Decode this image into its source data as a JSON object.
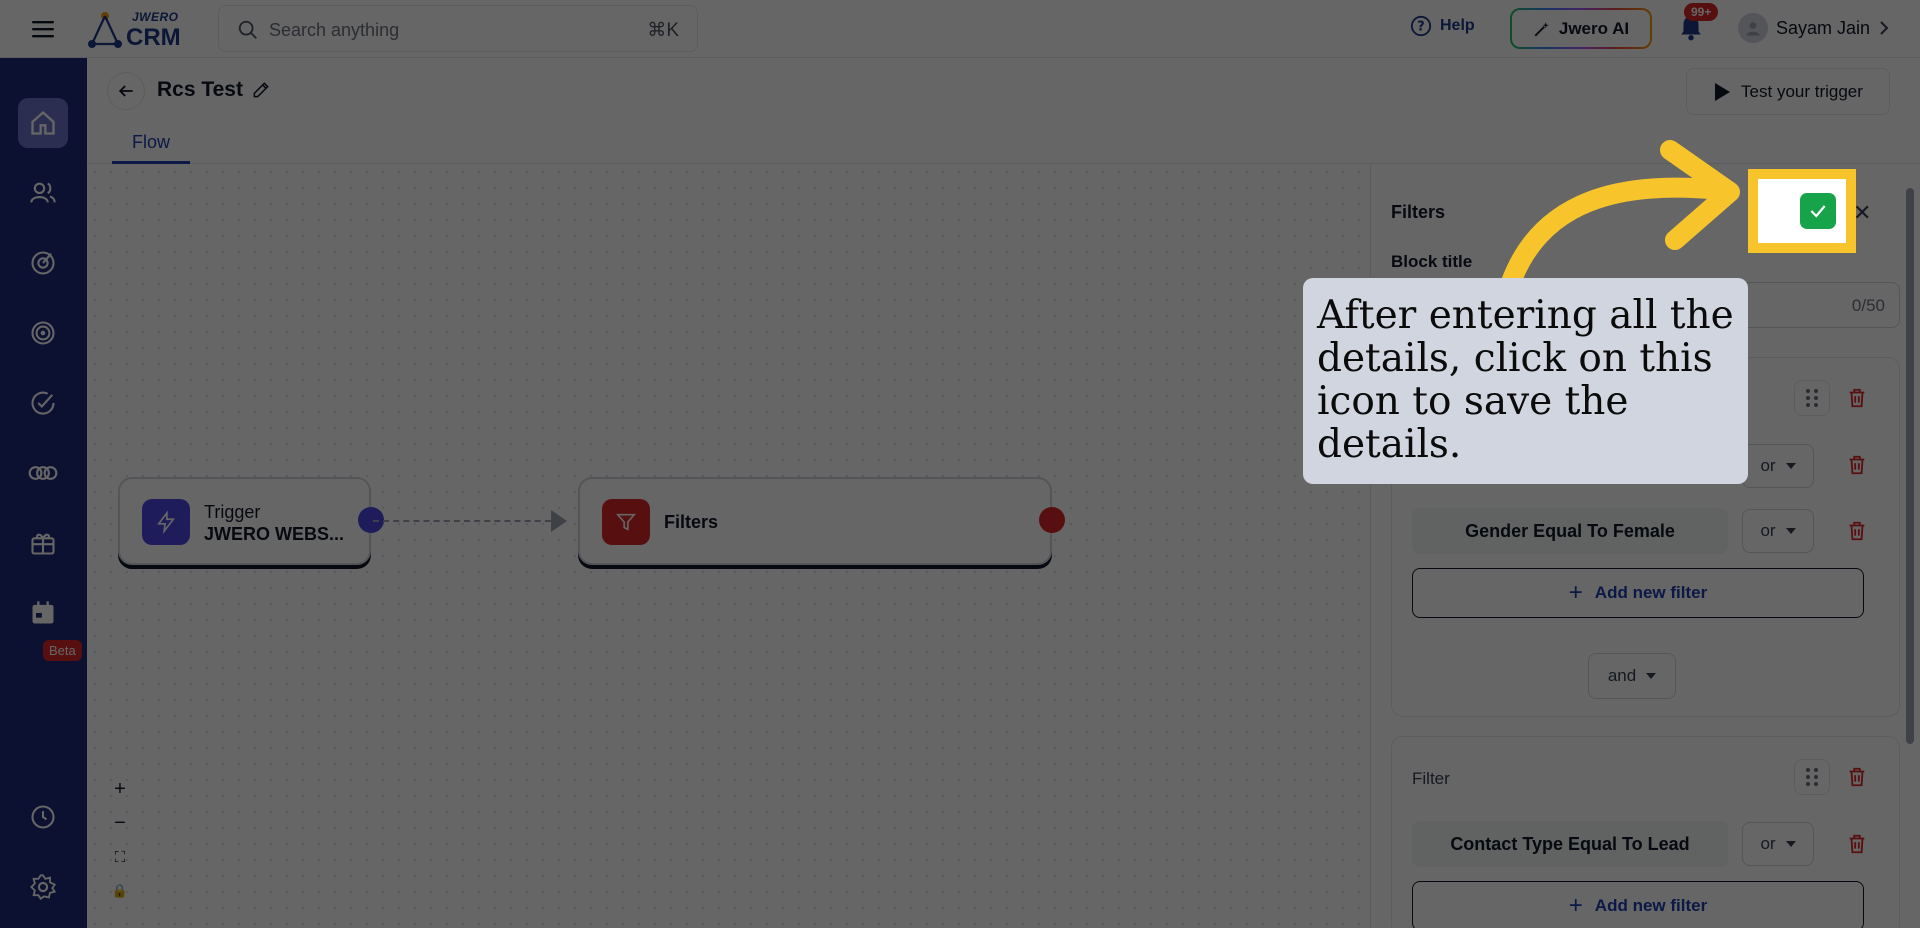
{
  "topbar": {
    "logo_small": "JWERO",
    "logo_big": "CRM",
    "search_placeholder": "Search anything",
    "search_shortcut": "⌘K",
    "help_label": "Help",
    "ai_label": "Jwero AI",
    "notification_count": "99+",
    "user_name": "Sayam Jain"
  },
  "sidebar": {
    "items": [
      "home-icon",
      "contacts-icon",
      "campaign-icon",
      "target-icon",
      "tasks-icon",
      "integrations-icon",
      "gift-icon",
      "calendar-icon",
      "history-icon",
      "settings-icon"
    ],
    "beta_label": "Beta",
    "active_color": "#6b74c9",
    "background": "#1e2a7a"
  },
  "header": {
    "title": "Rcs Test",
    "test_button": "Test your trigger",
    "tab": "Flow"
  },
  "canvas": {
    "trigger_node": {
      "title": "Trigger",
      "subtitle": "JWERO WEBS..."
    },
    "filter_node": {
      "title": "Filters"
    },
    "zoom_controls": [
      "+",
      "−",
      "⛶",
      "🔒"
    ]
  },
  "panel": {
    "title": "Filters",
    "block_title_label": "Block title",
    "block_title_counter": "0/50",
    "card1": {
      "rows": [
        {
          "condition": "",
          "operator": "or"
        },
        {
          "condition": "Gender Equal To Female",
          "operator": "or"
        }
      ],
      "add_filter": "Add new filter",
      "join_operator": "and"
    },
    "card2": {
      "label": "Filter",
      "rows": [
        {
          "condition": "Contact Type Equal To Lead",
          "operator": "or"
        }
      ],
      "add_filter": "Add new filter"
    }
  },
  "tooltip": {
    "text": "After entering all the details, click on this icon to save the details."
  },
  "colors": {
    "highlight": "#f7c52b",
    "save_green": "#16a34a",
    "danger": "#dc2626",
    "primary_blue": "#1e40af"
  }
}
